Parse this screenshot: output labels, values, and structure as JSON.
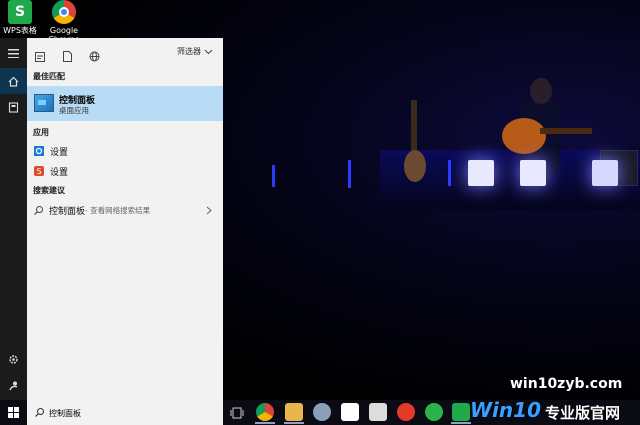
{
  "desktop": {
    "icons": [
      {
        "label": "WPS表格",
        "icon": "wps-sheet-icon"
      },
      {
        "label": "Google Chrome",
        "icon": "chrome-icon"
      }
    ]
  },
  "start_panel": {
    "toolbar": {
      "filter_label": "筛选器"
    },
    "best_match_heading": "最佳匹配",
    "best_match": {
      "title": "控制面板",
      "subtitle": "桌面应用",
      "icon": "control-panel-icon"
    },
    "apps_heading": "应用",
    "apps": [
      {
        "label": "设置",
        "icon": "settings-gear-icon"
      },
      {
        "label": "设置",
        "icon": "wps-settings-icon"
      }
    ],
    "suggest_heading": "搜索建议",
    "suggestion": {
      "term": "控制面板",
      "hint": " - 查看网络搜索结果"
    }
  },
  "search": {
    "query": "控制面板"
  },
  "watermark": {
    "site": "win10zyb.com",
    "brand_a": "Win10",
    "brand_b": "专业版官网"
  },
  "colors": {
    "accent": "#0078d7",
    "selected_row": "#b8dcf5",
    "panel_bg": "#f2f2f2",
    "rail_bg": "#1b1b1b",
    "taskbar_bg": "#0b0b14"
  }
}
